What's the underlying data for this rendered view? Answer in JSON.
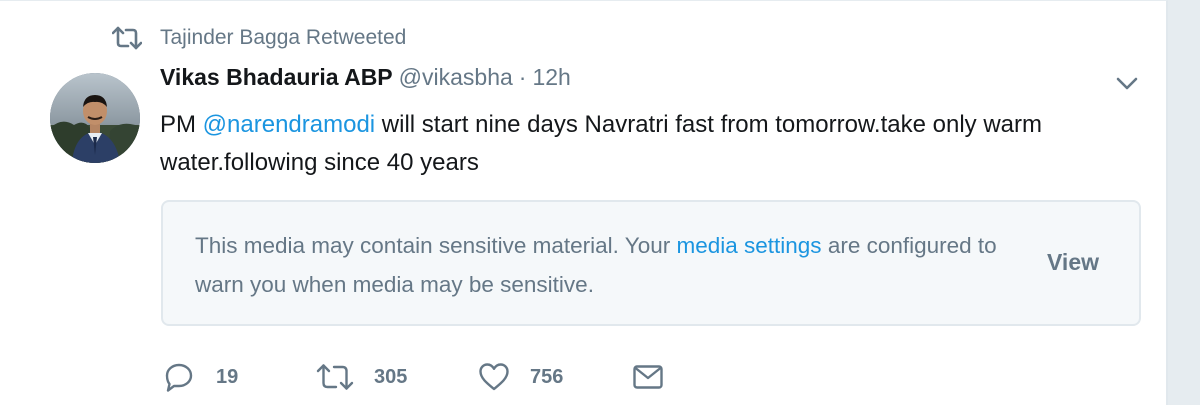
{
  "retweet_context": {
    "icon": "retweet-icon",
    "text": "Tajinder Bagga Retweeted"
  },
  "author": {
    "avatar": "avatar",
    "fullname": "Vikas Bhadauria ABP",
    "username": "@vikasbha",
    "separator": "·",
    "timestamp": "12h"
  },
  "caret_icon": "chevron-down-icon",
  "tweet": {
    "text_before": "PM ",
    "mention": "@narendramodi",
    "text_after": " will start nine days Navratri fast from tomorrow.take only warm water.following since 40 years"
  },
  "media_warning": {
    "text_before": "This media may contain sensitive material. Your ",
    "link_text": "media settings",
    "text_after": " are configured to warn you when media may be sensitive.",
    "view_label": "View"
  },
  "actions": {
    "reply_count": "19",
    "retweet_count": "305",
    "like_count": "756"
  },
  "colors": {
    "link": "#1b95e0",
    "secondary_text": "#657786",
    "primary_text": "#14171a",
    "card_background": "#f5f8fa",
    "border": "#e1e8ed"
  }
}
